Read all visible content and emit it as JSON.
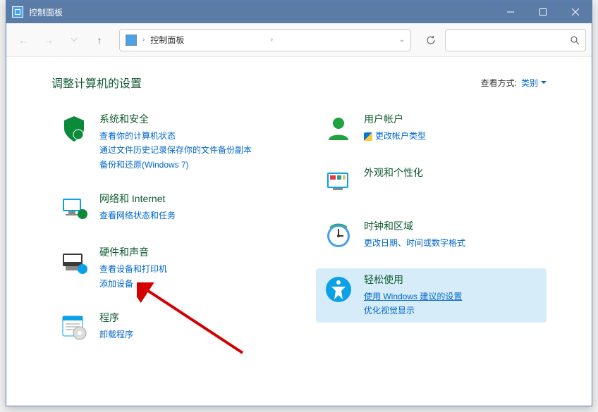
{
  "titlebar": {
    "title": "控制面板"
  },
  "address": {
    "path": "控制面板",
    "chevron": "›"
  },
  "search": {
    "placeholder": ""
  },
  "header": {
    "page_title": "调整计算机的设置",
    "view_by_label": "查看方式:",
    "view_by_value": "类别"
  },
  "left_categories": [
    {
      "key": "system",
      "title": "系统和安全",
      "links": [
        {
          "text": "查看你的计算机状态"
        },
        {
          "text": "通过文件历史记录保存你的文件备份副本"
        },
        {
          "text": "备份和还原(Windows 7)"
        }
      ]
    },
    {
      "key": "network",
      "title": "网络和 Internet",
      "links": [
        {
          "text": "查看网络状态和任务"
        }
      ]
    },
    {
      "key": "hardware",
      "title": "硬件和声音",
      "links": [
        {
          "text": "查看设备和打印机"
        },
        {
          "text": "添加设备"
        }
      ]
    },
    {
      "key": "programs",
      "title": "程序",
      "links": [
        {
          "text": "卸载程序"
        }
      ]
    }
  ],
  "right_categories": [
    {
      "key": "users",
      "title": "用户帐户",
      "links": [
        {
          "text": "更改帐户类型",
          "shield": true
        }
      ]
    },
    {
      "key": "appearance",
      "title": "外观和个性化",
      "links": []
    },
    {
      "key": "clock",
      "title": "时钟和区域",
      "links": [
        {
          "text": "更改日期、时间或数字格式"
        }
      ]
    },
    {
      "key": "ease",
      "title": "轻松使用",
      "highlighted": true,
      "links": [
        {
          "text": "使用 Windows 建议的设置",
          "underlined": true
        },
        {
          "text": "优化视觉显示"
        }
      ]
    }
  ]
}
